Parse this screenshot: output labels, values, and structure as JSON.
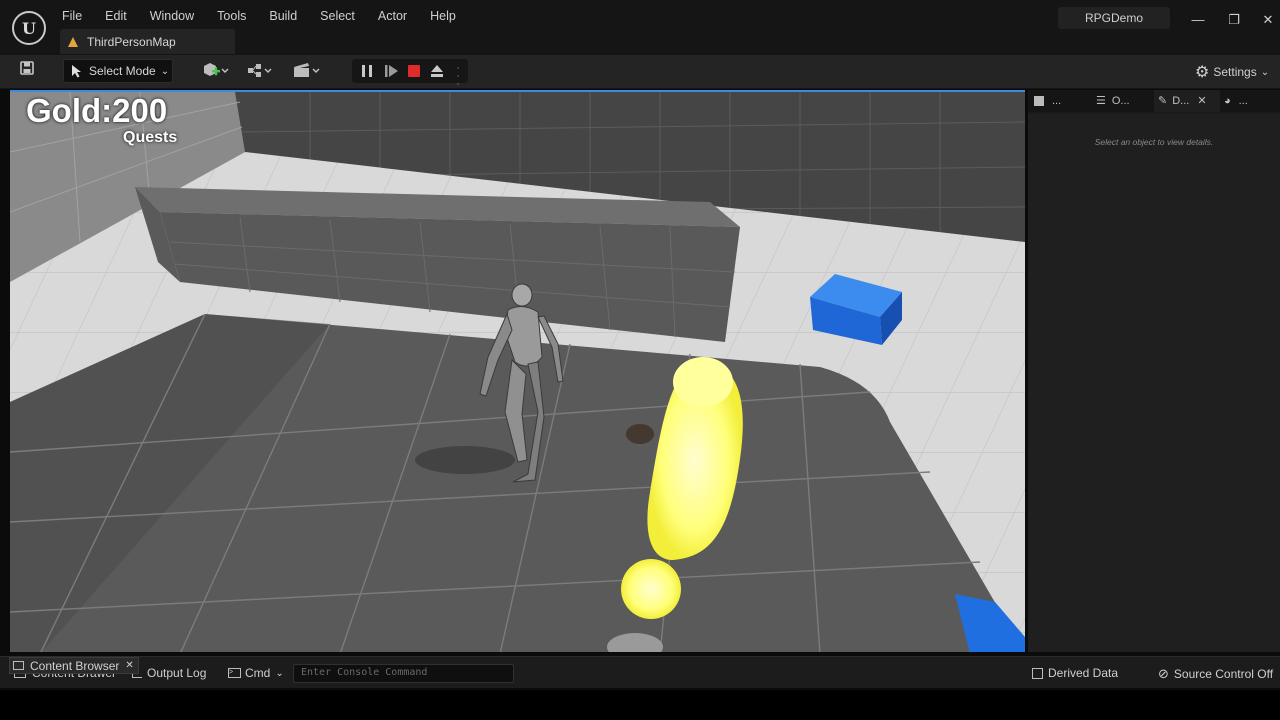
{
  "app": {
    "logo_text": "U",
    "project_name": "RPGDemo"
  },
  "menu": [
    "File",
    "Edit",
    "Window",
    "Tools",
    "Build",
    "Select",
    "Actor",
    "Help"
  ],
  "document_tab": {
    "label": "ThirdPersonMap"
  },
  "window_controls": {
    "minimize": "—",
    "restore": "❐",
    "close": "✕"
  },
  "toolbar": {
    "select_mode_label": "Select Mode",
    "settings_label": "Settings"
  },
  "hud": {
    "gold": "Gold:200",
    "quests": "Quests"
  },
  "right_panel": {
    "tabs": [
      {
        "label": "..."
      },
      {
        "label": "O..."
      },
      {
        "label": "D..."
      },
      {
        "label": "..."
      }
    ],
    "hint": "Select an object to view details."
  },
  "statusbar": {
    "content_drawer": "Content Drawer",
    "content_browser_tooltip": "Content Browser",
    "output_log": "Output Log",
    "cmd": "Cmd",
    "console_placeholder": "Enter Console Command",
    "derived_data": "Derived Data",
    "source_control": "Source Control Off"
  },
  "colors": {
    "accent_blue": "#3a8ce0",
    "stop_red": "#e02b2b",
    "quest_marker_yellow": "#ffff7a",
    "cube_blue": "#1f66d6"
  }
}
